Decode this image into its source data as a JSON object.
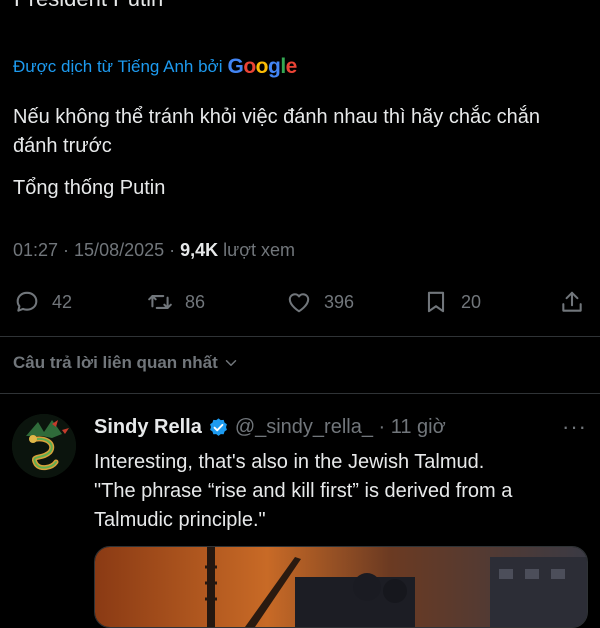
{
  "tweet": {
    "cut_title": "President Putin",
    "translated_prefix": "Được dịch từ Tiếng Anh bởi",
    "translator_letters": [
      "G",
      "o",
      "o",
      "g",
      "l",
      "e"
    ],
    "body_line1": "Nếu không thể tránh khỏi việc đánh nhau thì hãy chắc chắn đánh trước",
    "body_line2": "Tổng thống Putin",
    "time": "01:27 · 15/08/2025 · ",
    "views_count": "9,4K",
    "views_label": " lượt xem"
  },
  "actions": {
    "replies": "42",
    "reposts": "86",
    "likes": "396",
    "bookmarks": "20"
  },
  "related_label": "Câu trả lời liên quan nhất",
  "reply": {
    "name": "Sindy Rella",
    "handle_time": "@_sindy_rella_ · 11 giờ",
    "more": "···",
    "text_line1": "Interesting, that's also in the Jewish Talmud.",
    "text_line2": "\"The phrase “rise and kill first” is derived from a Talmudic principle.\""
  },
  "colors": {
    "background": "#000000",
    "link": "#1d9bf0",
    "muted": "#71767b",
    "verified": "#1d9bf0"
  },
  "icons": [
    "reply-icon",
    "repost-icon",
    "like-icon",
    "bookmark-icon",
    "share-icon",
    "chevron-down-icon",
    "verified-badge-icon",
    "more-icon"
  ]
}
